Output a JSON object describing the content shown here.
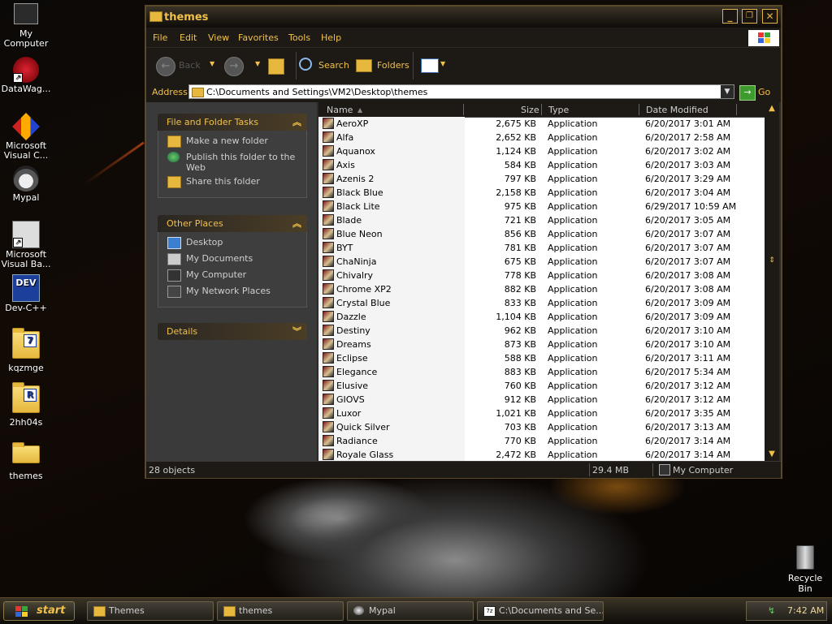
{
  "desktop": {
    "icons": [
      {
        "label_line1": "My",
        "label_line2": "Computer",
        "icon": "computer-icon"
      },
      {
        "label_line1": "DataWag...",
        "label_line2": "",
        "icon": "datawag-icon"
      },
      {
        "label_line1": "Microsoft",
        "label_line2": "Visual C...",
        "icon": "visual-c-icon"
      },
      {
        "label_line1": "Mypal",
        "label_line2": "",
        "icon": "mypal-icon"
      },
      {
        "label_line1": "Microsoft",
        "label_line2": "Visual Ba...",
        "icon": "visual-basic-icon"
      },
      {
        "label_line1": "Dev-C++",
        "label_line2": "",
        "icon": "devcpp-icon"
      },
      {
        "label_line1": "kqzmge",
        "label_line2": "",
        "icon": "folder-icon"
      },
      {
        "label_line1": "2hh04s",
        "label_line2": "",
        "icon": "folder-icon"
      },
      {
        "label_line1": "themes",
        "label_line2": "",
        "icon": "folder-icon"
      }
    ],
    "recycle_bin": "Recycle Bin"
  },
  "window": {
    "title": "themes",
    "menu": [
      "File",
      "Edit",
      "View",
      "Favorites",
      "Tools",
      "Help"
    ],
    "toolbar": {
      "back": "Back",
      "search": "Search",
      "folders": "Folders"
    },
    "address": {
      "label": "Address",
      "value": "C:\\Documents and Settings\\VM2\\Desktop\\themes",
      "go": "Go"
    },
    "task_pane": {
      "file_tasks": {
        "title": "File and Folder Tasks",
        "items": [
          "Make a new folder",
          "Publish this folder to the Web",
          "Share this folder"
        ]
      },
      "other_places": {
        "title": "Other Places",
        "items": [
          "Desktop",
          "My Documents",
          "My Computer",
          "My Network Places"
        ]
      },
      "details": {
        "title": "Details"
      }
    },
    "columns": {
      "name": "Name",
      "size": "Size",
      "type": "Type",
      "date": "Date Modified"
    },
    "files": [
      {
        "name": "AeroXP",
        "size": "2,675 KB",
        "type": "Application",
        "date": "6/20/2017 3:01 AM"
      },
      {
        "name": "Alfa",
        "size": "2,652 KB",
        "type": "Application",
        "date": "6/20/2017 2:58 AM"
      },
      {
        "name": "Aquanox",
        "size": "1,124 KB",
        "type": "Application",
        "date": "6/20/2017 3:02 AM"
      },
      {
        "name": "Axis",
        "size": "584 KB",
        "type": "Application",
        "date": "6/20/2017 3:03 AM"
      },
      {
        "name": "Azenis 2",
        "size": "797 KB",
        "type": "Application",
        "date": "6/20/2017 3:29 AM"
      },
      {
        "name": "Black Blue",
        "size": "2,158 KB",
        "type": "Application",
        "date": "6/20/2017 3:04 AM"
      },
      {
        "name": "Black Lite",
        "size": "975 KB",
        "type": "Application",
        "date": "6/29/2017 10:59 AM"
      },
      {
        "name": "Blade",
        "size": "721 KB",
        "type": "Application",
        "date": "6/20/2017 3:05 AM"
      },
      {
        "name": "Blue Neon",
        "size": "856 KB",
        "type": "Application",
        "date": "6/20/2017 3:07 AM"
      },
      {
        "name": "BYT",
        "size": "781 KB",
        "type": "Application",
        "date": "6/20/2017 3:07 AM"
      },
      {
        "name": "ChaNinja",
        "size": "675 KB",
        "type": "Application",
        "date": "6/20/2017 3:07 AM"
      },
      {
        "name": "Chivalry",
        "size": "778 KB",
        "type": "Application",
        "date": "6/20/2017 3:08 AM"
      },
      {
        "name": "Chrome XP2",
        "size": "882 KB",
        "type": "Application",
        "date": "6/20/2017 3:08 AM"
      },
      {
        "name": "Crystal Blue",
        "size": "833 KB",
        "type": "Application",
        "date": "6/20/2017 3:09 AM"
      },
      {
        "name": "Dazzle",
        "size": "1,104 KB",
        "type": "Application",
        "date": "6/20/2017 3:09 AM"
      },
      {
        "name": "Destiny",
        "size": "962 KB",
        "type": "Application",
        "date": "6/20/2017 3:10 AM"
      },
      {
        "name": "Dreams",
        "size": "873 KB",
        "type": "Application",
        "date": "6/20/2017 3:10 AM"
      },
      {
        "name": "Eclipse",
        "size": "588 KB",
        "type": "Application",
        "date": "6/20/2017 3:11 AM"
      },
      {
        "name": "Elegance",
        "size": "883 KB",
        "type": "Application",
        "date": "6/20/2017 5:34 AM"
      },
      {
        "name": "Elusive",
        "size": "760 KB",
        "type": "Application",
        "date": "6/20/2017 3:12 AM"
      },
      {
        "name": "GIOVS",
        "size": "912 KB",
        "type": "Application",
        "date": "6/20/2017 3:12 AM"
      },
      {
        "name": "Luxor",
        "size": "1,021 KB",
        "type": "Application",
        "date": "6/20/2017 3:35 AM"
      },
      {
        "name": "Quick Silver",
        "size": "703 KB",
        "type": "Application",
        "date": "6/20/2017 3:13 AM"
      },
      {
        "name": "Radiance",
        "size": "770 KB",
        "type": "Application",
        "date": "6/20/2017 3:14 AM"
      },
      {
        "name": "Royale Glass",
        "size": "2,472 KB",
        "type": "Application",
        "date": "6/20/2017 3:14 AM"
      }
    ],
    "status": {
      "count": "28 objects",
      "size": "29.4 MB",
      "location": "My Computer"
    }
  },
  "taskbar": {
    "start": "start",
    "tasks": [
      "Themes",
      "themes",
      "Mypal",
      "C:\\Documents and Se..."
    ],
    "clock": "7:42 AM"
  },
  "colors": {
    "accent": "#f2c14a",
    "window_frame": "#1d1a15"
  }
}
